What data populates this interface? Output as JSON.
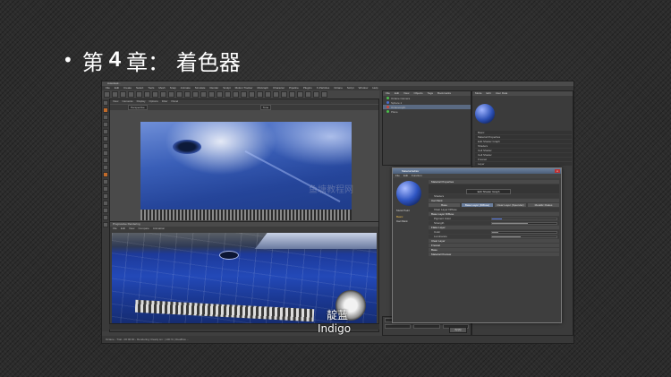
{
  "slide": {
    "bullet": "•",
    "title_prefix": "第",
    "title_num": "4",
    "title_suffix": "章： 着色器"
  },
  "app": {
    "title": "Autodesk...",
    "menu": [
      "File",
      "Edit",
      "Create",
      "Select",
      "Tools",
      "Mesh",
      "Snap",
      "Animate",
      "Simulate",
      "Render",
      "Sculpt",
      "Motion Tracker",
      "MoGraph",
      "Character",
      "Pipeline",
      "Plugins",
      "X-Particles",
      "Octane",
      "Script",
      "Window",
      "Help"
    ],
    "viewport": {
      "menu": [
        "View",
        "Cameras",
        "Display",
        "Options",
        "Filter",
        "Panel"
      ],
      "field_left": "Perspective",
      "field_right": "Tone"
    },
    "picture_viewer": {
      "title": "Progressive Rendering",
      "menu": [
        "File",
        "Edit",
        "View",
        "Compare",
        "Animation"
      ]
    },
    "watermark": "鱼塘教程网",
    "status": "Octane - Trial - 00:00:00 - Rendering: Ready  sm:  |  100 %  |  Realflow  ...",
    "objects": {
      "tabs": [
        "File",
        "Edit",
        "View",
        "Objects",
        "Tags",
        "Bookmarks"
      ],
      "items": [
        "Octane Camera",
        "Sphere.1",
        "OctaneLight",
        "Plane"
      ]
    },
    "attributes": {
      "tabs": [
        "Mode",
        "Edit",
        "User Data"
      ],
      "rows": [
        "Basic",
        "Material Properties",
        "Edit Shader Graph",
        "Shaders",
        "Cell Shader",
        "Cell Shader",
        "Fresnel",
        "Layer"
      ]
    },
    "coords": {
      "apply": "Apply"
    }
  },
  "material_editor": {
    "title": "Material Editor",
    "close": "x",
    "menu": [
      "File",
      "Edit",
      "Function"
    ],
    "name": "Metal Paint",
    "channels": [
      "Basic",
      "Car Paint"
    ],
    "rows": [
      {
        "label": "Material Properties",
        "kind": "head"
      },
      {
        "label": "Edit Shader Graph",
        "kind": "button"
      },
      {
        "label": "Shaders",
        "kind": "sub"
      },
      {
        "label": "Car Paint",
        "kind": "head"
      }
    ],
    "tabs": [
      "Base",
      "Base Layer (Diffuse)",
      "Clear Layer (Specular)",
      "Metallic Flakes"
    ],
    "params": [
      {
        "label": "Clear Layer Diffuse",
        "kind": "sub"
      },
      {
        "label": "Base Layer Diffuse",
        "kind": "head"
      },
      {
        "label": "Pigment Color",
        "kind": "sub",
        "slider": "blue",
        "fill": 0.15
      },
      {
        "label": "Strength",
        "kind": "sub",
        "slider": "grey",
        "fill": 0.55
      },
      {
        "label": "Flake Layer",
        "kind": "head"
      },
      {
        "label": "Color",
        "kind": "sub",
        "slider": "grey",
        "fill": 0.1
      },
      {
        "label": "Luminance",
        "kind": "sub",
        "slider": "grey",
        "fill": 0.45
      }
    ],
    "sections": [
      "Clear Layer",
      "Fresnel",
      "Base",
      "Material Preview"
    ]
  },
  "subtitle": {
    "zh": "靛蓝",
    "en": "Indigo"
  }
}
